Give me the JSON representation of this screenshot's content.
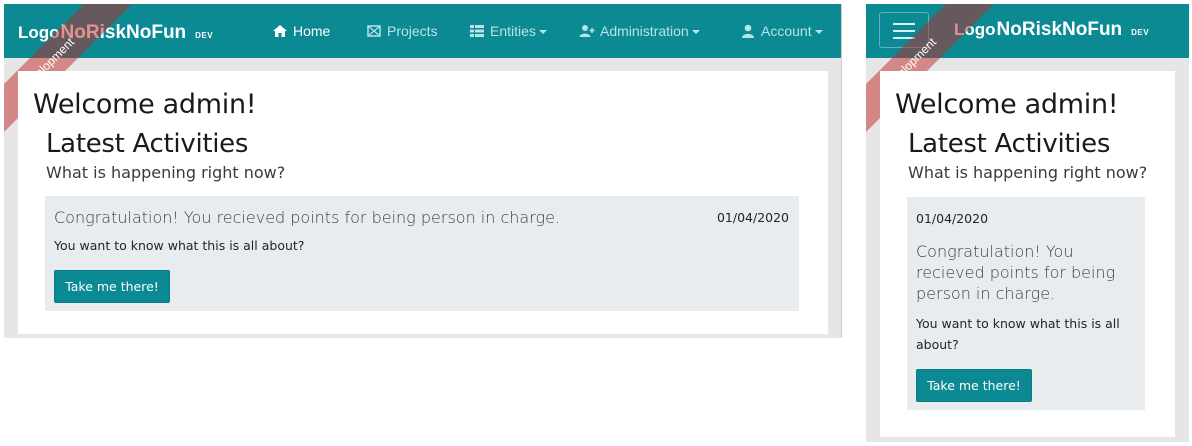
{
  "brand": {
    "logo": "Logo",
    "name": "NoRiskNoFun",
    "env": "DEV",
    "ribbon": "Development"
  },
  "nav": {
    "items": [
      {
        "label": "Home",
        "icon": "home-icon",
        "active": true
      },
      {
        "label": "Projects",
        "icon": "projects-icon",
        "active": false
      },
      {
        "label": "Entities",
        "icon": "list-icon",
        "active": false,
        "dropdown": true
      },
      {
        "label": "Administration",
        "icon": "user-plus-icon",
        "active": false,
        "dropdown": true
      },
      {
        "label": "Account",
        "icon": "user-icon",
        "active": false,
        "dropdown": true
      }
    ]
  },
  "page": {
    "welcome": "Welcome admin!",
    "latest_title": "Latest Activities",
    "latest_subtitle": "What is happening right now?"
  },
  "activity": {
    "message": "Congratulation! You recieved points for being person in charge.",
    "date": "01/04/2020",
    "question": "You want to know what this is all about?",
    "button": "Take me there!"
  },
  "colors": {
    "primary": "#0b8a93",
    "ribbon": "#c02828",
    "panel": "#e9ecef",
    "page_bg": "#e6e6e6"
  }
}
